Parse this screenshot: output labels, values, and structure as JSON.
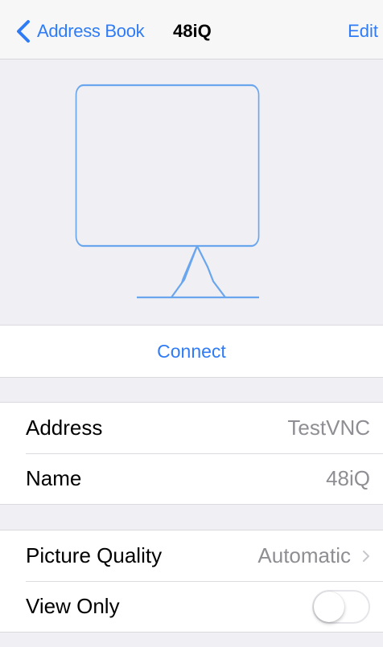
{
  "nav": {
    "back_label": "Address Book",
    "title": "48iQ",
    "edit_label": "Edit"
  },
  "connect": {
    "label": "Connect"
  },
  "details": {
    "address_label": "Address",
    "address_value": "TestVNC",
    "name_label": "Name",
    "name_value": "48iQ"
  },
  "settings": {
    "picture_quality_label": "Picture Quality",
    "picture_quality_value": "Automatic",
    "view_only_label": "View Only",
    "view_only_on": false
  },
  "colors": {
    "accent": "#2f7cf6",
    "monitor_stroke": "#6aa6ee",
    "background": "#efeff4",
    "secondary_text": "#8e8e93"
  },
  "icons": {
    "back": "chevron-left-icon",
    "monitor": "monitor-icon",
    "disclosure": "chevron-right-icon"
  }
}
